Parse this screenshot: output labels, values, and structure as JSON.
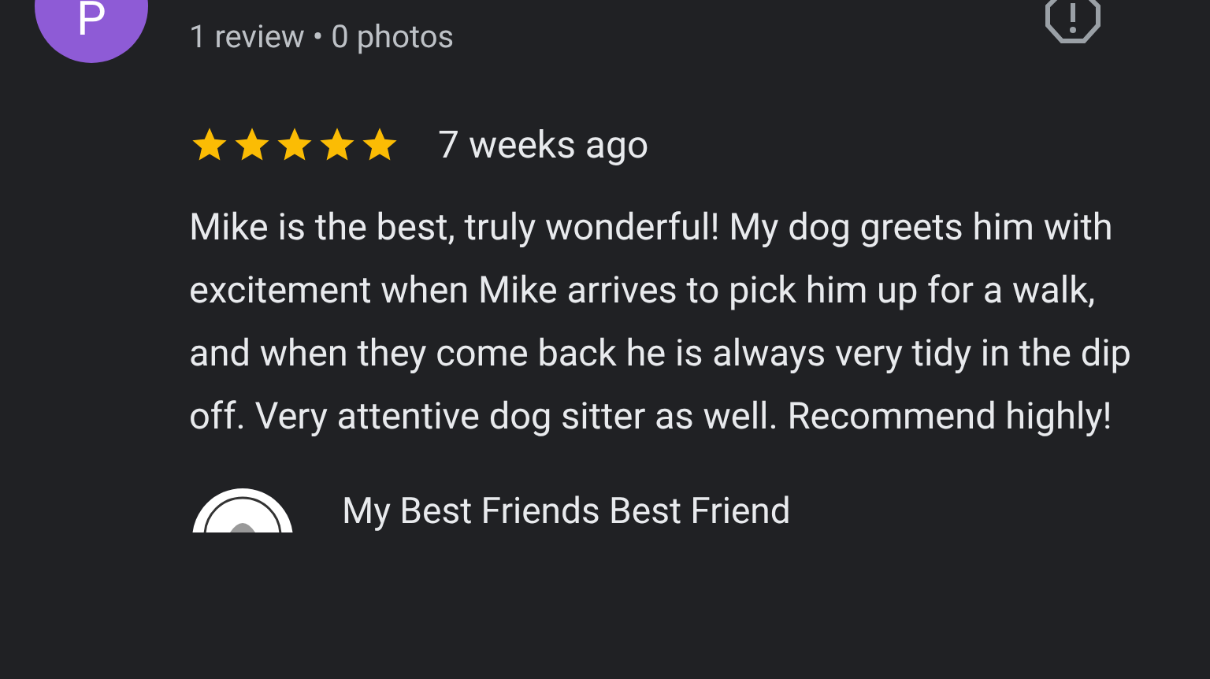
{
  "reviewer": {
    "initial": "P",
    "meta": "1 review • 0 photos"
  },
  "review": {
    "stars": 5,
    "date": "7 weeks ago",
    "text": "Mike is the best, truly wonderful! My dog greets him with excitement when Mike arrives to pick him up for a walk, and when they come back he is always very tidy in the dip off. Very attentive dog sitter as well. Recommend highly!"
  },
  "owner_response": {
    "name": "My Best Friends Best Friend"
  }
}
